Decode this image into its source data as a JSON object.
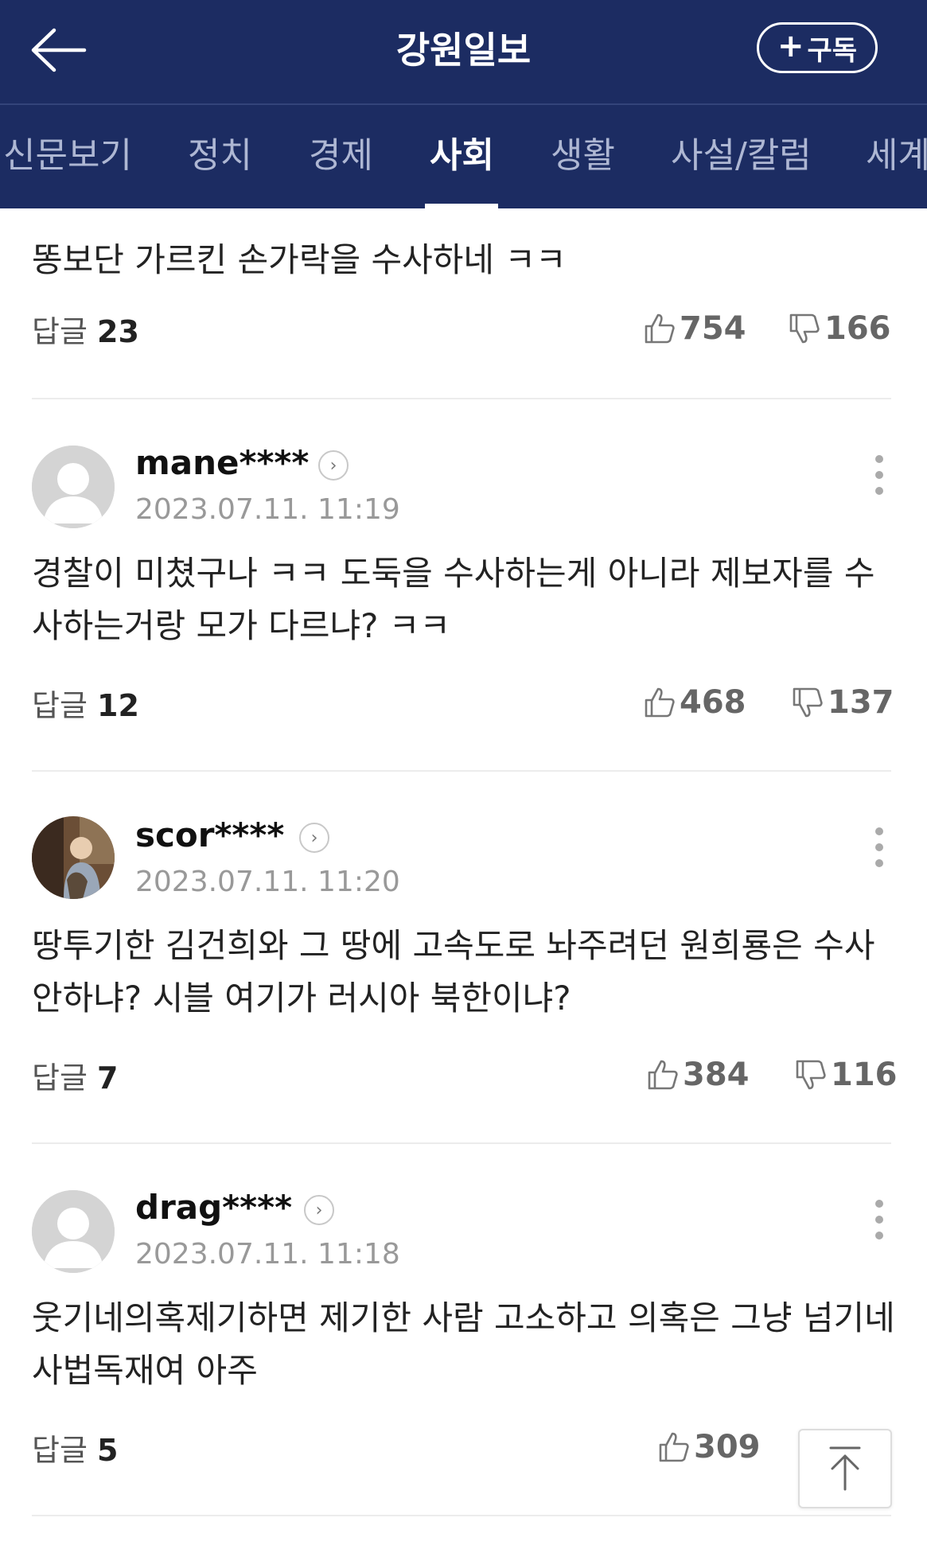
{
  "header": {
    "title": "강원일보",
    "subscribe_label": "구독",
    "subscribe_plus": "+"
  },
  "tabs": [
    {
      "label": "신문보기"
    },
    {
      "label": "정치"
    },
    {
      "label": "경제"
    },
    {
      "label": "사회",
      "active": true
    },
    {
      "label": "생활"
    },
    {
      "label": "사설/칼럼"
    },
    {
      "label": "세계"
    }
  ],
  "reply_label": "답글",
  "top_comment": {
    "text": "똥보단 가르킨 손가락을 수사하네 ㅋㅋ",
    "replies": "23",
    "likes": "754",
    "dislikes": "166"
  },
  "comments": [
    {
      "username": "mane****",
      "timestamp": "2023.07.11. 11:19",
      "text": "경찰이 미쳤구나 ㅋㅋ 도둑을 수사하는게 아니라 제보자를 수사하는거랑 모가 다르냐? ㅋㅋ",
      "replies": "12",
      "likes": "468",
      "dislikes": "137",
      "avatar": "default"
    },
    {
      "username": "scor****",
      "timestamp": "2023.07.11. 11:20",
      "text": "땅투기한 김건희와 그 땅에 고속도로 놔주려던 원희룡은 수사안하냐? 시블 여기가 러시아 북한이냐?",
      "replies": "7",
      "likes": "384",
      "dislikes": "116",
      "avatar": "photo"
    },
    {
      "username": "drag****",
      "timestamp": "2023.07.11. 11:18",
      "text": "웃기네의혹제기하면 제기한 사람 고소하고 의혹은 그냥 넘기네 사법독재여 아주",
      "replies": "5",
      "likes": "309",
      "avatar": "default"
    }
  ],
  "colors": {
    "header_bg": "#1c2c62",
    "tab_inactive": "#aeb7d3",
    "text_primary": "#222222",
    "meta_gray": "#999999"
  },
  "icons": [
    "back-arrow-icon",
    "plus-icon",
    "thumbs-up-icon",
    "thumbs-down-icon",
    "more-vertical-icon",
    "chevron-right-icon",
    "arrow-up-icon",
    "default-avatar-icon"
  ]
}
